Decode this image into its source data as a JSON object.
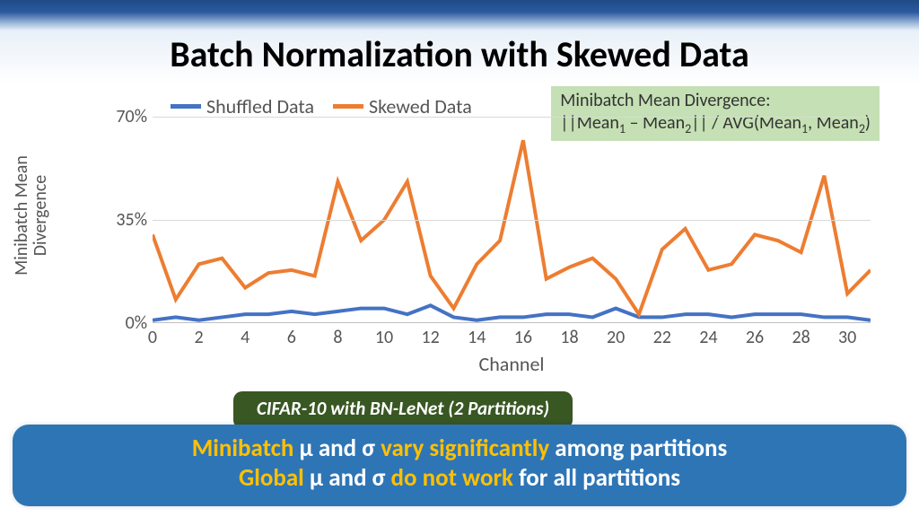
{
  "title": "Batch Normalization with Skewed Data",
  "legend": {
    "shuffled": "Shuffled Data",
    "skewed": "Skewed Data"
  },
  "formula": {
    "line1": "Minibatch Mean Divergence:",
    "line2_html": "||Mean<sub>1</sub> – Mean<sub>2</sub>|| / AVG(Mean<sub>1</sub>, Mean<sub>2</sub>)"
  },
  "ylabel_html": "Minibatch Mean<br>Divergence",
  "xlabel": "Channel",
  "caption": "CIFAR-10 with BN-LeNet (2 Partitions)",
  "banner": {
    "l1_a": "Minibatch",
    "l1_b": " μ and σ ",
    "l1_c": "vary significantly",
    "l1_d": " among partitions",
    "l2_a": "Global",
    "l2_b": " μ and σ ",
    "l2_c": "do not work",
    "l2_d": " for all partitions"
  },
  "chart_data": {
    "type": "line",
    "xlabel": "Channel",
    "ylabel": "Minibatch Mean Divergence",
    "x": [
      0,
      1,
      2,
      3,
      4,
      5,
      6,
      7,
      8,
      9,
      10,
      11,
      12,
      13,
      14,
      15,
      16,
      17,
      18,
      19,
      20,
      21,
      22,
      23,
      24,
      25,
      26,
      27,
      28,
      29,
      30,
      31
    ],
    "x_ticks": [
      0,
      2,
      4,
      6,
      8,
      10,
      12,
      14,
      16,
      18,
      20,
      22,
      24,
      26,
      28,
      30
    ],
    "y_ticks": [
      "0%",
      "35%",
      "70%"
    ],
    "ylim": [
      0,
      70
    ],
    "series": [
      {
        "name": "Shuffled Data",
        "color": "#4472c4",
        "values": [
          1,
          2,
          1,
          2,
          3,
          3,
          4,
          3,
          4,
          5,
          5,
          3,
          6,
          2,
          1,
          2,
          2,
          3,
          3,
          2,
          5,
          2,
          2,
          3,
          3,
          2,
          3,
          3,
          3,
          2,
          2,
          1
        ]
      },
      {
        "name": "Skewed Data",
        "color": "#ed7d31",
        "values": [
          30,
          8,
          20,
          22,
          12,
          17,
          18,
          16,
          48,
          28,
          35,
          48,
          16,
          5,
          20,
          28,
          62,
          15,
          19,
          22,
          15,
          3,
          25,
          32,
          18,
          20,
          30,
          28,
          24,
          50,
          10,
          18
        ]
      }
    ]
  }
}
